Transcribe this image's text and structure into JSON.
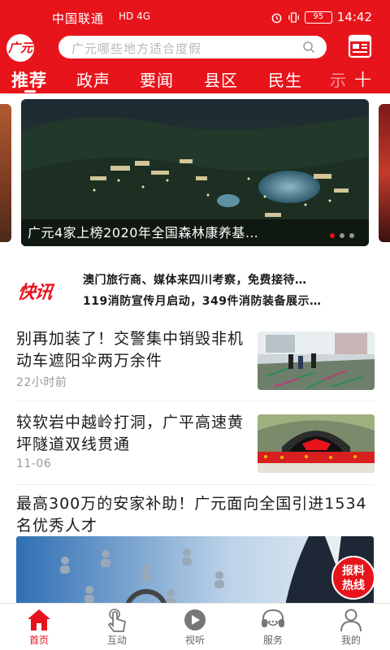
{
  "status_bar": {
    "carrier": "中国联通",
    "network": "HD 4G",
    "battery": "95",
    "time": "14:42"
  },
  "header": {
    "logo_text": "广元",
    "search_placeholder": "广元哪些地方适合度假",
    "news_icon_label": "NEWS"
  },
  "tabs": [
    {
      "label": "推荐",
      "active": true
    },
    {
      "label": "政声",
      "active": false
    },
    {
      "label": "要闻",
      "active": false
    },
    {
      "label": "县区",
      "active": false
    },
    {
      "label": "民生",
      "active": false
    }
  ],
  "tab_overflow": "示",
  "tab_add": "+",
  "carousel": {
    "caption": "广元4家上榜2020年全国森林康养基…",
    "dots_total": 3,
    "dot_active": 1
  },
  "kuaixun": {
    "label": "快讯",
    "items": [
      "澳门旅行商、媒体来四川考察，免费接待…",
      "119消防宣传月启动，349件消防装备展示…"
    ]
  },
  "news": [
    {
      "title": "别再加装了！交警集中销毁非机动车遮阳伞两万余件",
      "time": "22小时前"
    },
    {
      "title": "较软岩中越岭打洞，广平高速黄坪隧道双线贯通",
      "time": "11-06"
    }
  ],
  "feature": {
    "title": "最高300万的安家补助！广元面向全国引进1534名优秀人才"
  },
  "baoliao": {
    "line1": "报料",
    "line2": "热线"
  },
  "bottom_nav": [
    {
      "label": "首页",
      "icon": "home-icon",
      "active": true
    },
    {
      "label": "互动",
      "icon": "touch-icon",
      "active": false
    },
    {
      "label": "视听",
      "icon": "play-icon",
      "active": false
    },
    {
      "label": "服务",
      "icon": "headset-icon",
      "active": false
    },
    {
      "label": "我的",
      "icon": "user-icon",
      "active": false
    }
  ],
  "colors": {
    "brand_red": "#e8141b",
    "text_dark": "#1a1a1a",
    "text_gray": "#9a9a9a"
  }
}
